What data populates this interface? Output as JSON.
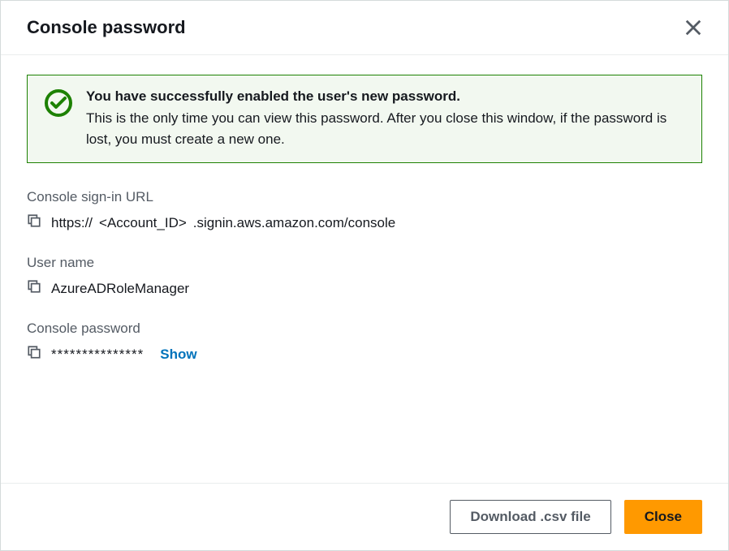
{
  "header": {
    "title": "Console password"
  },
  "alert": {
    "title": "You have successfully enabled the user's new password.",
    "message": "This is the only time you can view this password. After you close this window, if the password is lost, you must create a new one."
  },
  "fields": {
    "signInUrl": {
      "label": "Console sign-in URL",
      "prefix": "https://",
      "accountPlaceholder": "<Account_ID>",
      "suffix": ".signin.aws.amazon.com/console"
    },
    "userName": {
      "label": "User name",
      "value": "AzureADRoleManager"
    },
    "password": {
      "label": "Console password",
      "masked": "***************",
      "showLabel": "Show"
    }
  },
  "footer": {
    "downloadLabel": "Download .csv file",
    "closeLabel": "Close"
  }
}
